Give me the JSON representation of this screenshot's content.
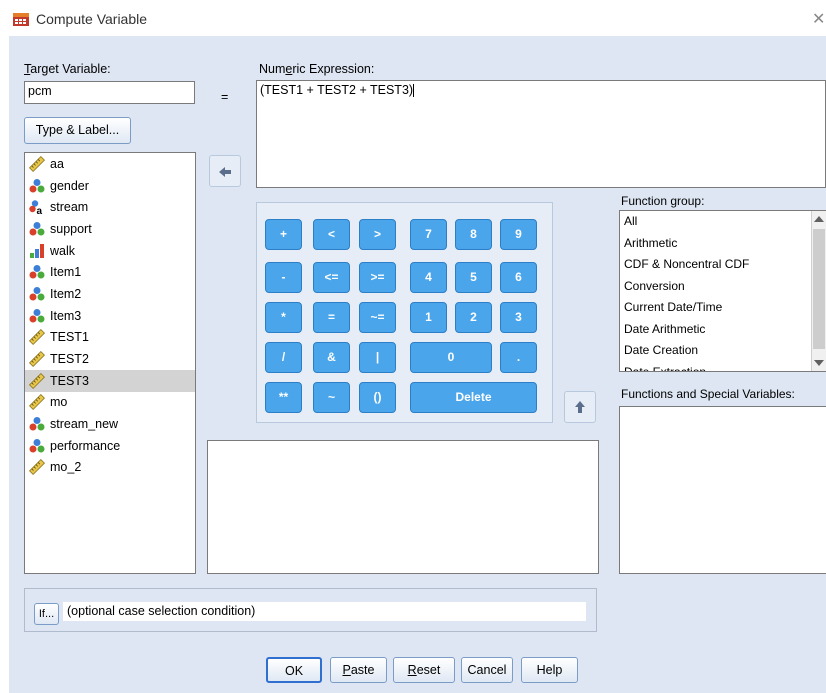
{
  "window": {
    "title": "Compute Variable"
  },
  "target": {
    "label": "Target Variable:",
    "value": "pcm",
    "type_label_button": "Type & Label..."
  },
  "equals": "=",
  "expression": {
    "label": "Numeric Expression:",
    "value": "(TEST1 + TEST2 + TEST3)"
  },
  "variables": [
    {
      "name": "aa",
      "icon": "ruler-icon"
    },
    {
      "name": "gender",
      "icon": "nominal-icon"
    },
    {
      "name": "stream",
      "icon": "nominal-string-icon"
    },
    {
      "name": "support",
      "icon": "nominal-icon"
    },
    {
      "name": "walk",
      "icon": "ordinal-icon"
    },
    {
      "name": "Item1",
      "icon": "nominal-icon"
    },
    {
      "name": "Item2",
      "icon": "nominal-icon"
    },
    {
      "name": "Item3",
      "icon": "nominal-icon"
    },
    {
      "name": "TEST1",
      "icon": "ruler-icon"
    },
    {
      "name": "TEST2",
      "icon": "ruler-icon"
    },
    {
      "name": "TEST3",
      "icon": "ruler-icon",
      "selected": true
    },
    {
      "name": "mo",
      "icon": "ruler-icon"
    },
    {
      "name": "stream_new",
      "icon": "nominal-icon"
    },
    {
      "name": "performance",
      "icon": "nominal-icon"
    },
    {
      "name": "mo_2",
      "icon": "ruler-icon"
    }
  ],
  "calculator": {
    "plus": "+",
    "lt": "<",
    "gt": ">",
    "n7": "7",
    "n8": "8",
    "n9": "9",
    "minus": "-",
    "le": "<=",
    "ge": ">=",
    "n4": "4",
    "n5": "5",
    "n6": "6",
    "mult": "*",
    "eq": "=",
    "ne": "~=",
    "n1": "1",
    "n2": "2",
    "n3": "3",
    "div": "/",
    "and": "&",
    "or": "|",
    "n0": "0",
    "dot": ".",
    "pow": "**",
    "not": "~",
    "paren": "()",
    "delete": "Delete"
  },
  "function_group": {
    "label": "Function group:",
    "items": [
      "All",
      "Arithmetic",
      "CDF & Noncentral CDF",
      "Conversion",
      "Current Date/Time",
      "Date Arithmetic",
      "Date Creation",
      "Date Extraction"
    ]
  },
  "functions_label": "Functions and Special Variables:",
  "if_section": {
    "button": "If...",
    "text": "(optional case selection condition)"
  },
  "buttons": {
    "ok": "OK",
    "paste": "Paste",
    "reset": "Reset",
    "cancel": "Cancel",
    "help": "Help"
  },
  "colors": {
    "dialog_bg": "#dde6f2",
    "calc_button": "#4aa5ea",
    "selection": "#d3d3d3"
  }
}
